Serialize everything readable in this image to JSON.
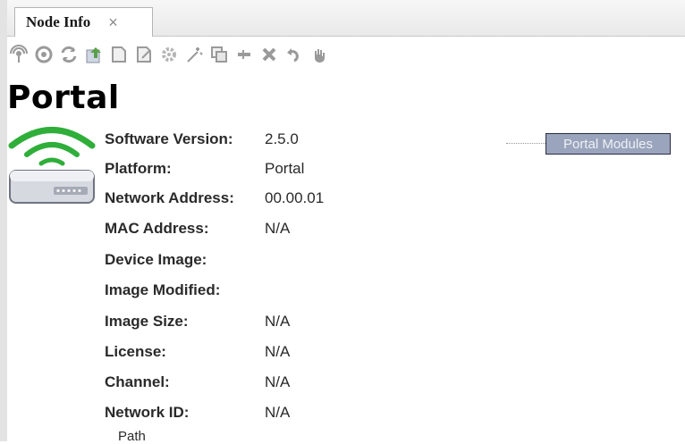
{
  "tab": {
    "title": "Node Info",
    "close": "×"
  },
  "toolbar": [
    {
      "name": "ping-icon",
      "color": "#9a9a9a"
    },
    {
      "name": "probe-icon",
      "color": "#9a9a9a"
    },
    {
      "name": "refresh-icon",
      "color": "#9a9a9a"
    },
    {
      "name": "upload-image-icon",
      "color": "#5aa04a"
    },
    {
      "name": "document-icon",
      "color": "#9a9a9a"
    },
    {
      "name": "document-edit-icon",
      "color": "#9a9a9a"
    },
    {
      "name": "gear-icon",
      "color": "#b5b5b5"
    },
    {
      "name": "wand-icon",
      "color": "#9a9a9a"
    },
    {
      "name": "copy-icon",
      "color": "#9a9a9a"
    },
    {
      "name": "remove-icon",
      "color": "#9a9a9a"
    },
    {
      "name": "delete-icon",
      "color": "#9a9a9a"
    },
    {
      "name": "undo-icon",
      "color": "#9a9a9a"
    },
    {
      "name": "hand-icon",
      "color": "#9a9a9a"
    }
  ],
  "node": {
    "title": "Portal",
    "properties": [
      {
        "label": "Software Version:",
        "value": "2.5.0"
      },
      {
        "label": "Platform:",
        "value": "Portal"
      },
      {
        "label": "Network Address:",
        "value": "00.00.01"
      },
      {
        "label": "MAC Address:",
        "value": "N/A"
      },
      {
        "label": "Device Image:",
        "value": ""
      },
      {
        "label": "Image Modified:",
        "value": ""
      },
      {
        "label": "Image Size:",
        "value": "N/A"
      },
      {
        "label": "License:",
        "value": "N/A"
      },
      {
        "label": "Channel:",
        "value": "N/A"
      },
      {
        "label": "Network ID:",
        "value": "N/A"
      },
      {
        "label": "Path",
        "value": ""
      }
    ]
  },
  "modules": {
    "label": "Portal Modules"
  },
  "colors": {
    "signal_green": "#2fae3a",
    "module_fill": "#9aa4bc",
    "module_border": "#2b2f44"
  }
}
